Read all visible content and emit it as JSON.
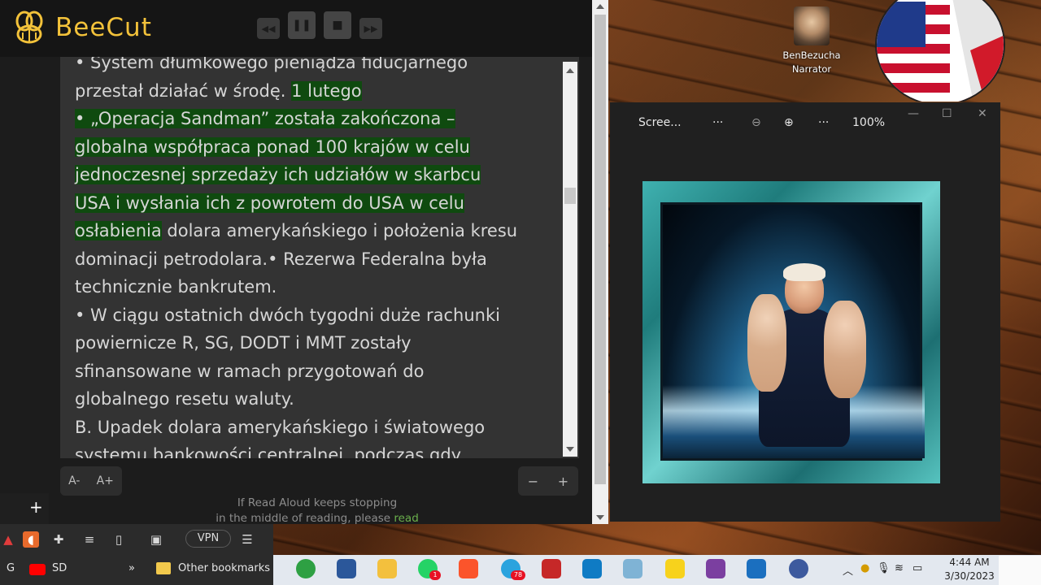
{
  "app": {
    "name": "BeeCut",
    "logo_icon": "bee-logo-icon",
    "player_controls": [
      "rewind-icon",
      "pause-icon",
      "stop-icon",
      "forward-icon"
    ]
  },
  "reader": {
    "lines": [
      {
        "text": "• System dłumkowego pieniądza fiducjarnego",
        "highlight": false
      },
      {
        "text": "przestał działać w środę. ",
        "extra": "1 lutego",
        "highlight_extra": true
      },
      {
        "text": "• „Operacja Sandman” została zakończona –",
        "highlight": true
      },
      {
        "text": "globalna współpraca ponad 100 krajów w celu",
        "highlight": true
      },
      {
        "text": "jednoczesnej sprzedaży ich udziałów w skarbcu",
        "highlight": true
      },
      {
        "text": "USA i wysłania ich z powrotem do USA w celu",
        "highlight": true
      },
      {
        "text": "osłabienia",
        "extra": " dolara amerykańskiego i położenia kresu",
        "highlight_first": true
      },
      {
        "text": "dominacji petrodolara.• Rezerwa Federalna była",
        "highlight": false
      },
      {
        "text": "technicznie bankrutem.",
        "highlight": false
      },
      {
        "text": "• W ciągu ostatnich dwóch tygodni duże rachunki",
        "highlight": false
      },
      {
        "text": "powiernicze R, SG, DODT i MMT zostały",
        "highlight": false
      },
      {
        "text": "sfinansowane w ramach przygotowań do",
        "highlight": false
      },
      {
        "text": "globalnego resetu waluty.",
        "highlight": false
      },
      {
        "text": "B. Upadek dolara amerykańskiego i światowego",
        "highlight": false
      },
      {
        "text": "systemu bankowości centralnej, podczas gdy",
        "highlight": false
      }
    ],
    "font_smaller": "A-",
    "font_larger": "A+",
    "speed_minus": "−",
    "speed_plus": "+",
    "hint_line1": "If Read Aloud keeps stopping",
    "hint_line2": "in the middle of reading, please ",
    "hint_link": "read"
  },
  "narrator": {
    "name_line1": "BenBezucha",
    "name_line2": "Narrator"
  },
  "viewer": {
    "title": "Scree...",
    "more1": "···",
    "more2": "···",
    "zoom": "100%",
    "zoom_out_icon": "zoom-out-icon",
    "zoom_in_icon": "zoom-in-icon",
    "minimize": "—",
    "maximize": "☐",
    "close": "✕"
  },
  "browser": {
    "new_tab": "+",
    "vpn": "VPN",
    "bookmarks": {
      "g": "G",
      "sd": "SD",
      "more": "»",
      "other": "Other bookmarks"
    }
  },
  "taskbar": {
    "badge_telegram": "78",
    "badge_whatsapp": "1",
    "time": "4:44 AM",
    "date": "3/30/2023",
    "colors": {
      "word": "#2b579a",
      "explorer": "#f3c03d",
      "whatsapp": "#25d366",
      "brave": "#fb542b",
      "telegram": "#2aa3de",
      "edge": "#0f7bc4"
    }
  }
}
